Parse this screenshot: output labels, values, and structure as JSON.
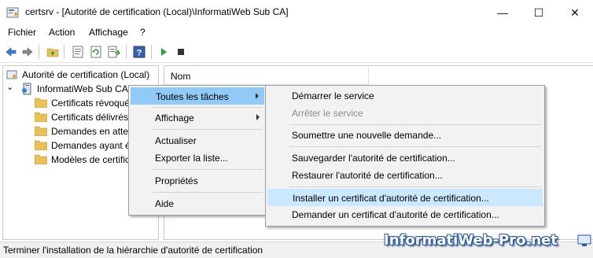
{
  "window": {
    "title": "certsrv - [Autorité de certification (Local)\\InformatiWeb Sub CA]",
    "minimize_glyph": "—",
    "maximize_glyph": "☐",
    "close_glyph": "✕"
  },
  "menubar": {
    "items": [
      "Fichier",
      "Action",
      "Affichage",
      "?"
    ]
  },
  "toolbar": {
    "icons": [
      "back-arrow-icon",
      "forward-arrow-icon",
      "up-folder-icon",
      "properties-icon",
      "refresh-icon",
      "export-list-icon",
      "help-icon",
      "start-service-icon",
      "stop-service-icon"
    ]
  },
  "tree": {
    "root": "Autorité de certification (Local)",
    "ca": "InformatiWeb Sub CA",
    "folders": [
      "Certificats révoqués",
      "Certificats délivrés",
      "Demandes en attente",
      "Demandes ayant échoué",
      "Modèles de certificats"
    ]
  },
  "list": {
    "column_name": "Nom"
  },
  "context_menu": {
    "items": [
      "Toutes les tâches",
      "Affichage",
      "Actualiser",
      "Exporter la liste...",
      "Propriétés",
      "Aide"
    ]
  },
  "submenu": {
    "items": [
      "Démarrer le service",
      "Arrêter le service",
      "Soumettre une nouvelle demande...",
      "Sauvegarder l'autorité de certification...",
      "Restaurer l'autorité de certification...",
      "Installer un certificat d'autorité de certification...",
      "Demander un certificat d'autorité de certification..."
    ]
  },
  "statusbar": {
    "text": "Terminer l'installation de la hiérarchie d'autorité de certification"
  },
  "watermark": {
    "text": "InformatiWeb-Pro.net"
  },
  "colors": {
    "highlight": "#91c9f7",
    "menu_bg": "#f2f2f2",
    "folder": "#e8c15a"
  }
}
